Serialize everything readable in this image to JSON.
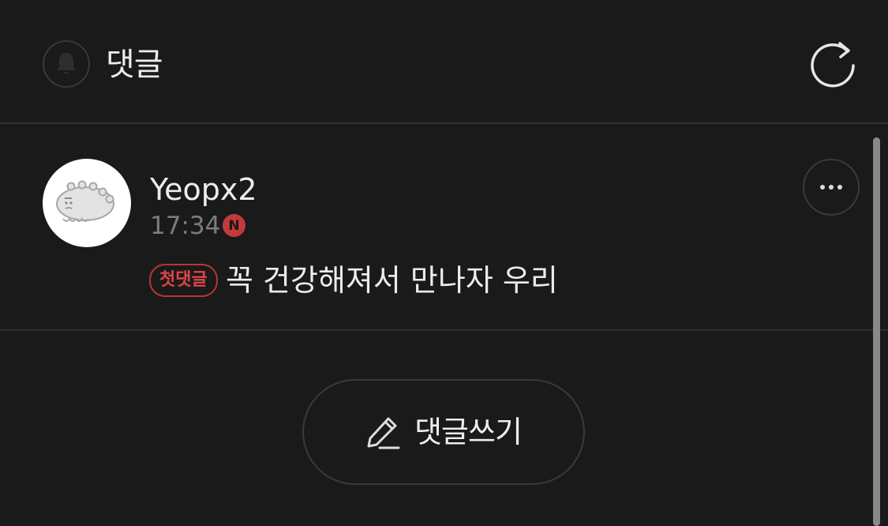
{
  "header": {
    "title": "댓글",
    "bell_icon": "bell-icon",
    "refresh_icon": "refresh-icon"
  },
  "comment": {
    "username": "Yeopx2",
    "time": "17:34",
    "new_badge": "N",
    "first_comment_badge": "첫댓글",
    "text": "꼭 건강해져서 만나자 우리",
    "more_icon": "more-horizontal-icon"
  },
  "write_button": {
    "label": "댓글쓰기",
    "icon": "pencil-icon"
  },
  "colors": {
    "background": "#1b1a1b",
    "accent_red": "#c33a3a",
    "text": "#ececec",
    "muted": "#7d7c7d"
  }
}
